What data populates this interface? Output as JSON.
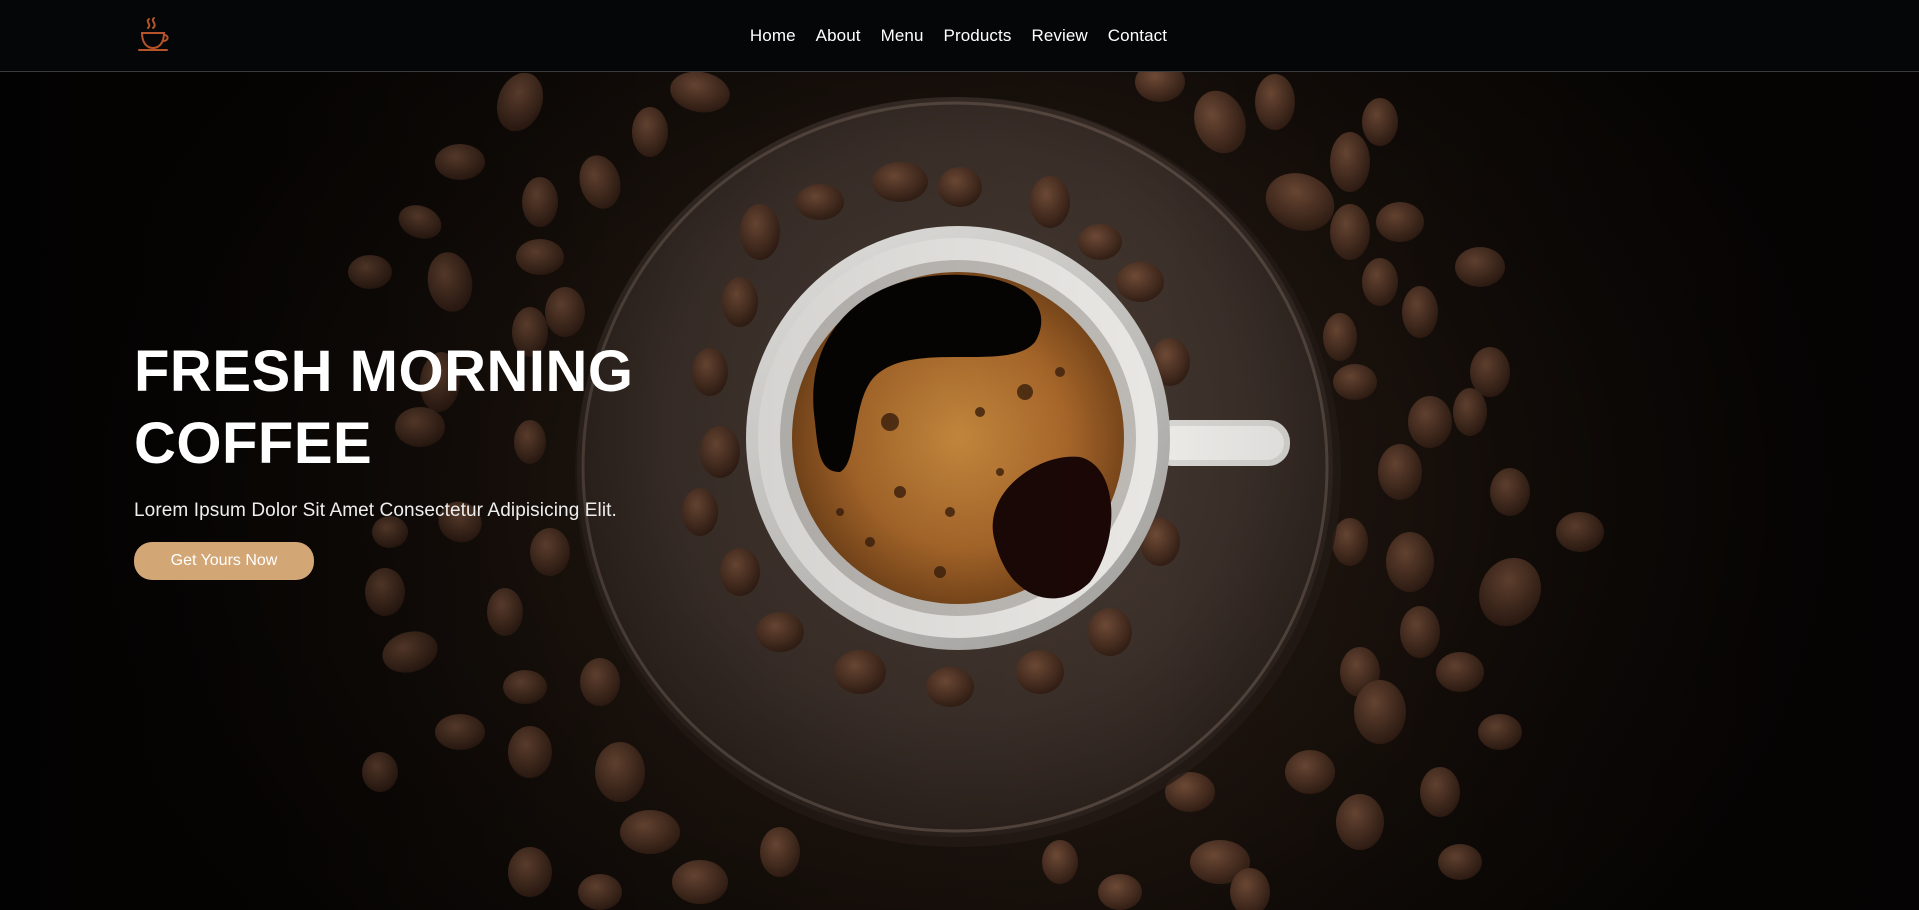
{
  "nav": {
    "logo_icon": "coffee-cup-logo-icon",
    "links": [
      {
        "label": "Home"
      },
      {
        "label": "About"
      },
      {
        "label": "Menu"
      },
      {
        "label": "Products"
      },
      {
        "label": "Review"
      },
      {
        "label": "Contact"
      }
    ]
  },
  "hero": {
    "title": "FRESH MORNING COFFEE",
    "subtitle": "Lorem Ipsum Dolor Sit Amet Consectetur Adipisicing Elit.",
    "button_label": "Get Yours Now",
    "image": "coffee-cup-with-beans-image"
  },
  "colors": {
    "accent": "#d3a676",
    "nav_background": "#050608",
    "logo": "#b5532a"
  }
}
